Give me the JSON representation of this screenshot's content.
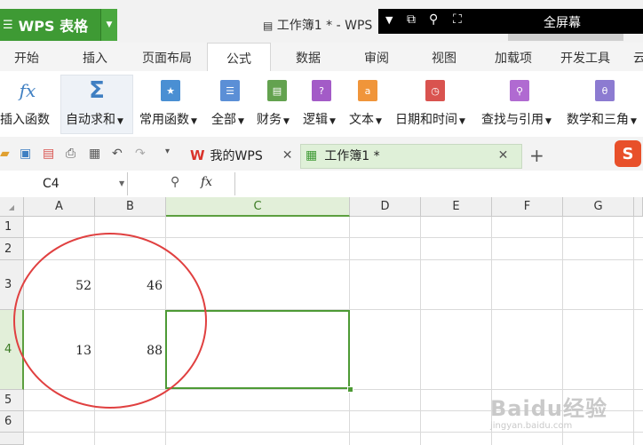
{
  "titlebar": {
    "app_name": "WPS 表格",
    "doc_title": "工作簿1 * - WPS",
    "fullscreen_label": "全屏幕"
  },
  "ribbon_tabs": [
    "开始",
    "插入",
    "页面布局",
    "公式",
    "数据",
    "审阅",
    "视图",
    "加载项",
    "开发工具",
    "云"
  ],
  "active_tab": "公式",
  "ribbon": {
    "insert_function": "插入函数",
    "fx_glyph": "fx",
    "autosum": "自动求和",
    "sigma_glyph": "Σ",
    "common_functions": "常用函数",
    "all": "全部",
    "finance": "财务",
    "logic": "逻辑",
    "text": "文本",
    "datetime": "日期和时间",
    "lookup": "查找与引用",
    "math": "数学和三角"
  },
  "doc_tabs": {
    "my_wps": "我的WPS",
    "workbook": "工作簿1 *"
  },
  "formula_bar": {
    "name_box": "C4",
    "fx_label": "fx",
    "content": ""
  },
  "sheet": {
    "columns": [
      "A",
      "B",
      "C",
      "D",
      "E",
      "F",
      "G"
    ],
    "rows": [
      "1",
      "2",
      "3",
      "4",
      "5",
      "6"
    ],
    "selected_cell": "C4",
    "values": {
      "A3": "52",
      "B3": "46",
      "A4": "13",
      "B4": "88"
    }
  },
  "watermark": {
    "main": "Baidu经验",
    "sub": "jingyan.baidu.com"
  },
  "colors": {
    "app_green": "#3e9a34",
    "selection_green": "#4d9a35",
    "annotation_red": "#e04040"
  }
}
